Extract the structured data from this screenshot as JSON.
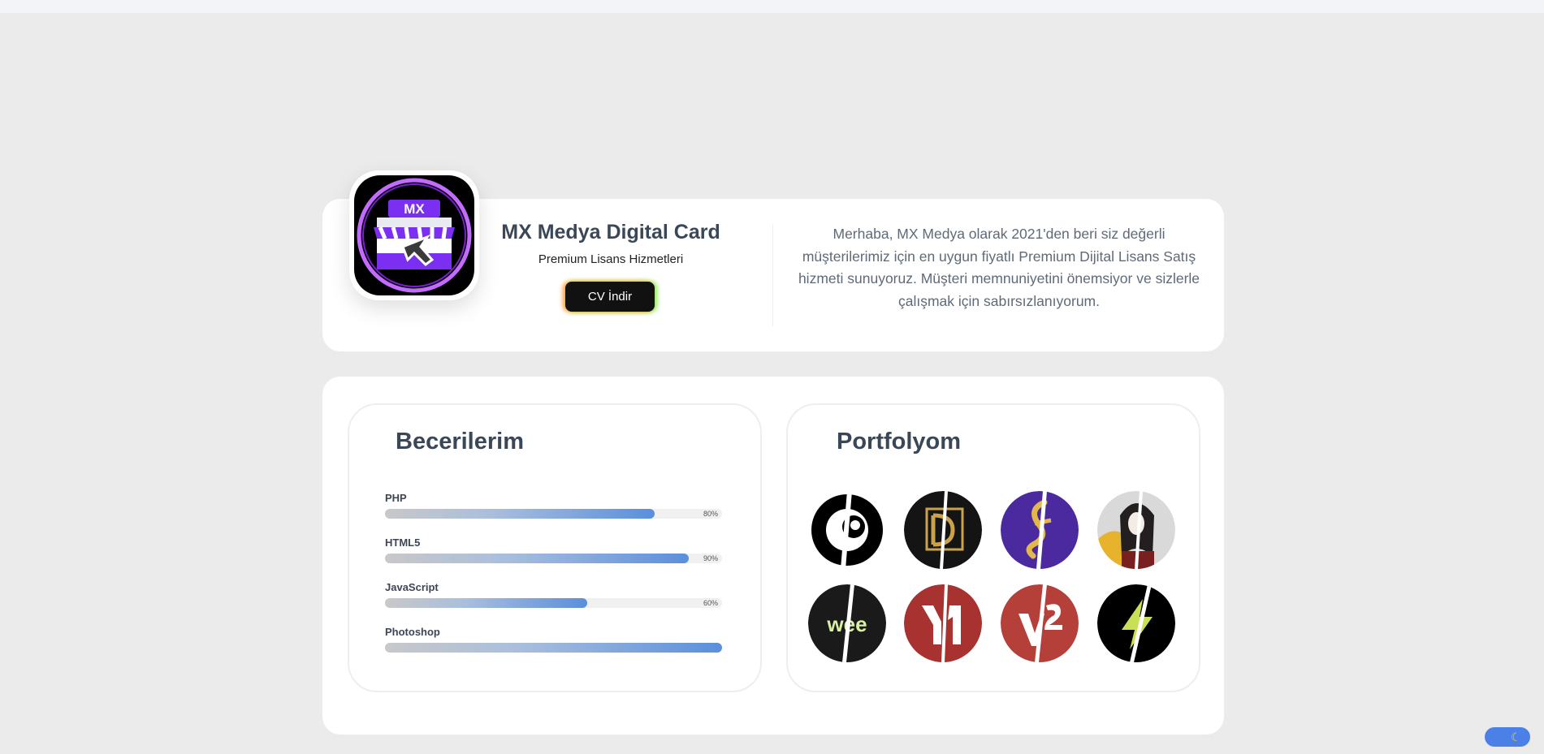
{
  "profile": {
    "title": "MX Medya Digital Card",
    "subtitle": "Premium Lisans Hizmetleri",
    "cv_button": "CV İndir",
    "logo_text": "MX",
    "intro": "Merhaba, MX Medya olarak 2021'den beri siz değerli müşterilerimiz için en uygun fiyatlı Premium Dijital Lisans Satış hizmeti sunuyoruz. Müşteri memnuniyetini önemsiyor ve sizlerle çalışmak için sabırsızlanıyorum."
  },
  "skills": {
    "title": "Becerilerim",
    "items": [
      {
        "name": "PHP",
        "percent": 80,
        "percent_label": "80%"
      },
      {
        "name": "HTML5",
        "percent": 90,
        "percent_label": "90%"
      },
      {
        "name": "JavaScript",
        "percent": 60,
        "percent_label": "60%"
      },
      {
        "name": "Photoshop",
        "percent": 100,
        "percent_label": ""
      }
    ]
  },
  "portfolio": {
    "title": "Portfolyom",
    "items": [
      "c-logo",
      "d-monogram-logo",
      "g-note-logo",
      "portrait-illustration",
      "wee-logo",
      "y1-logo",
      "v2-logo",
      "bolt-logo"
    ]
  },
  "theme_toggle": {
    "icon": "moon-icon"
  },
  "colors": {
    "accent": "#4b80e6",
    "heading": "#3a4757",
    "logo_purple": "#8a2be2"
  }
}
